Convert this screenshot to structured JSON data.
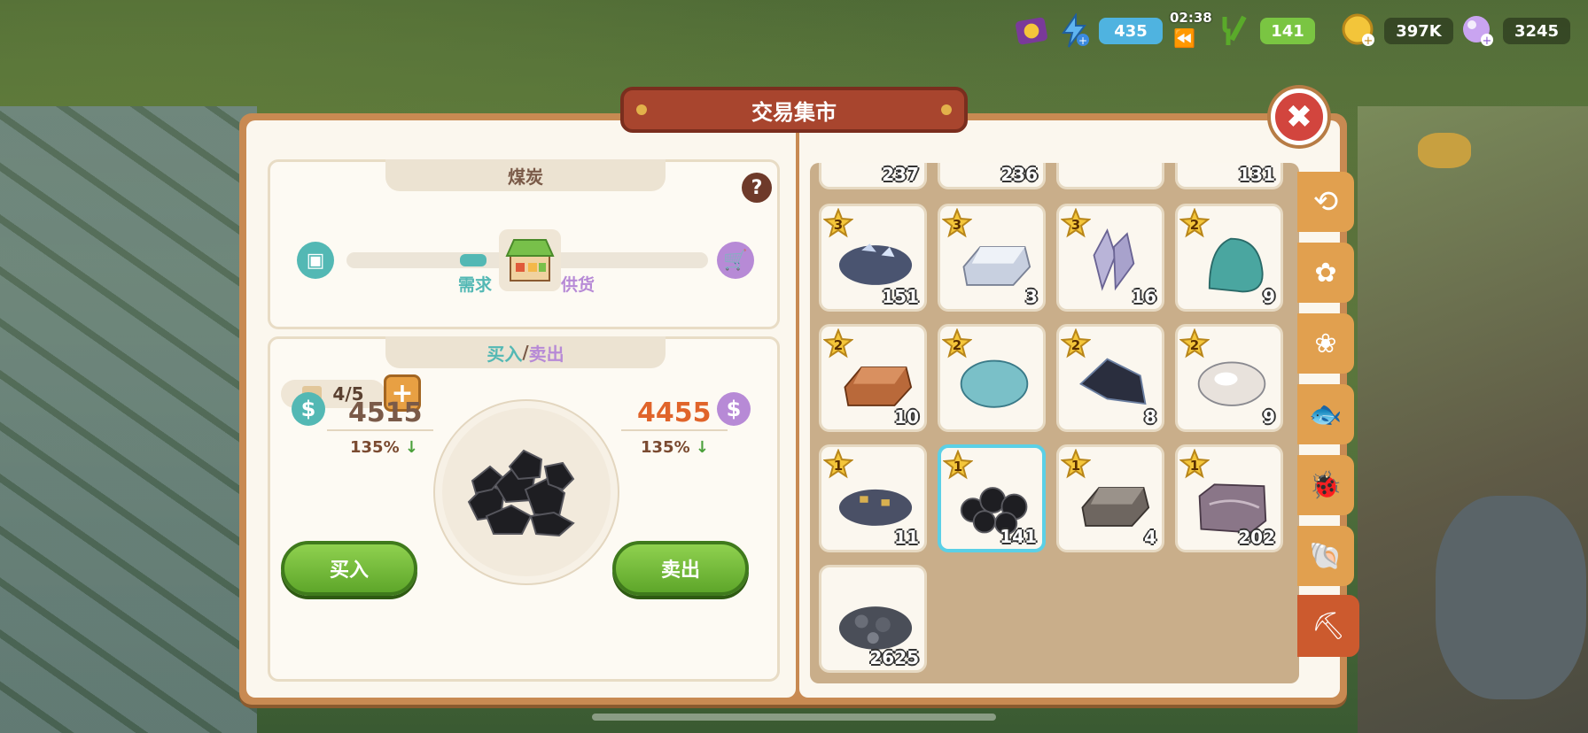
{
  "hud": {
    "energy": "435",
    "timer": "02:38",
    "food": "141",
    "coins": "397K",
    "gems": "3245"
  },
  "window": {
    "title": "交易集市",
    "close": "✖"
  },
  "item_panel": {
    "name": "煤炭",
    "help": "?",
    "demand_label": "需求",
    "supply_label": "供货",
    "demand_level": 0.35
  },
  "trade": {
    "buy_tab": "买入",
    "separator": "/",
    "sell_tab": "卖出",
    "slots": "4/5",
    "buy_price": "4515",
    "buy_pct": "135%",
    "sell_price": "4455",
    "sell_pct": "135%",
    "buy_button": "买入",
    "sell_button": "卖出"
  },
  "inventory": {
    "top_row_counts": [
      "237",
      "236",
      "",
      "131"
    ],
    "items": [
      {
        "name": "silver-ore",
        "stars": "3",
        "count": "151"
      },
      {
        "name": "silver-ingot",
        "stars": "3",
        "count": "3"
      },
      {
        "name": "amethyst-crystal",
        "stars": "3",
        "count": "16"
      },
      {
        "name": "turquoise-ore",
        "stars": "2",
        "count": "9"
      },
      {
        "name": "copper-ingot",
        "stars": "2",
        "count": "10"
      },
      {
        "name": "aquamarine-ore",
        "stars": "2",
        "count": ""
      },
      {
        "name": "obsidian-shard",
        "stars": "2",
        "count": "8"
      },
      {
        "name": "pearl-stone",
        "stars": "2",
        "count": "9"
      },
      {
        "name": "gold-speck-ore",
        "stars": "1",
        "count": "11"
      },
      {
        "name": "coal",
        "stars": "1",
        "count": "141"
      },
      {
        "name": "iron-ingot",
        "stars": "1",
        "count": "4"
      },
      {
        "name": "marble-block",
        "stars": "1",
        "count": "202"
      },
      {
        "name": "gravel",
        "stars": "",
        "count": "2625"
      }
    ]
  },
  "colors": {
    "accent_teal": "#53b8b4",
    "accent_purple": "#b78ad6",
    "buy_price_color": "#7a5a48",
    "sell_price_color": "#e0642a",
    "button_green": "#6ab532"
  }
}
